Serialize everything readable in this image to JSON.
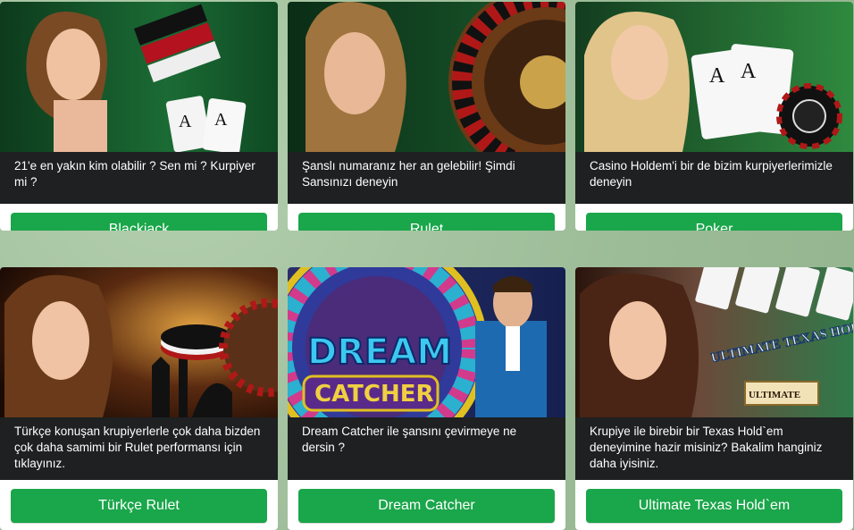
{
  "games": [
    {
      "description": "21'e en yakın kim olabilir ? Sen mi ? Kurpiyer mi ?",
      "button": "Blackjack"
    },
    {
      "description": "Şanslı numaranız her an gelebilir! Şimdi Sansınızı deneyin",
      "button": "Rulet"
    },
    {
      "description": "Casino Holdem'i bir de bizim kurpiyerlerimizle deneyin",
      "button": "Poker"
    },
    {
      "description": "Türkçe konuşan krupiyerlerle çok daha bizden çok daha samimi bir Rulet performansı için tıklayınız.",
      "button": "Türkçe Rulet"
    },
    {
      "description": "Dream Catcher ile şansını çevirmeye ne dersin ?",
      "button": "Dream Catcher"
    },
    {
      "description": "Krupiye ile birebir bir Texas Hold`em deneyimine hazir misiniz? Bakalim hanginiz daha iyisiniz.",
      "button": "Ultimate Texas Hold`em"
    }
  ],
  "image_text": {
    "dream": "DREAM",
    "catcher": "CATCHER",
    "ultimate_texas": "ULTIMATE TEXAS HOLD'EM",
    "ultimate_logo": "ULTIMATE"
  },
  "colors": {
    "page_bg": "#9fbf9a",
    "card_desc_bg": "#1e2021",
    "button_green": "#1aa64a"
  }
}
